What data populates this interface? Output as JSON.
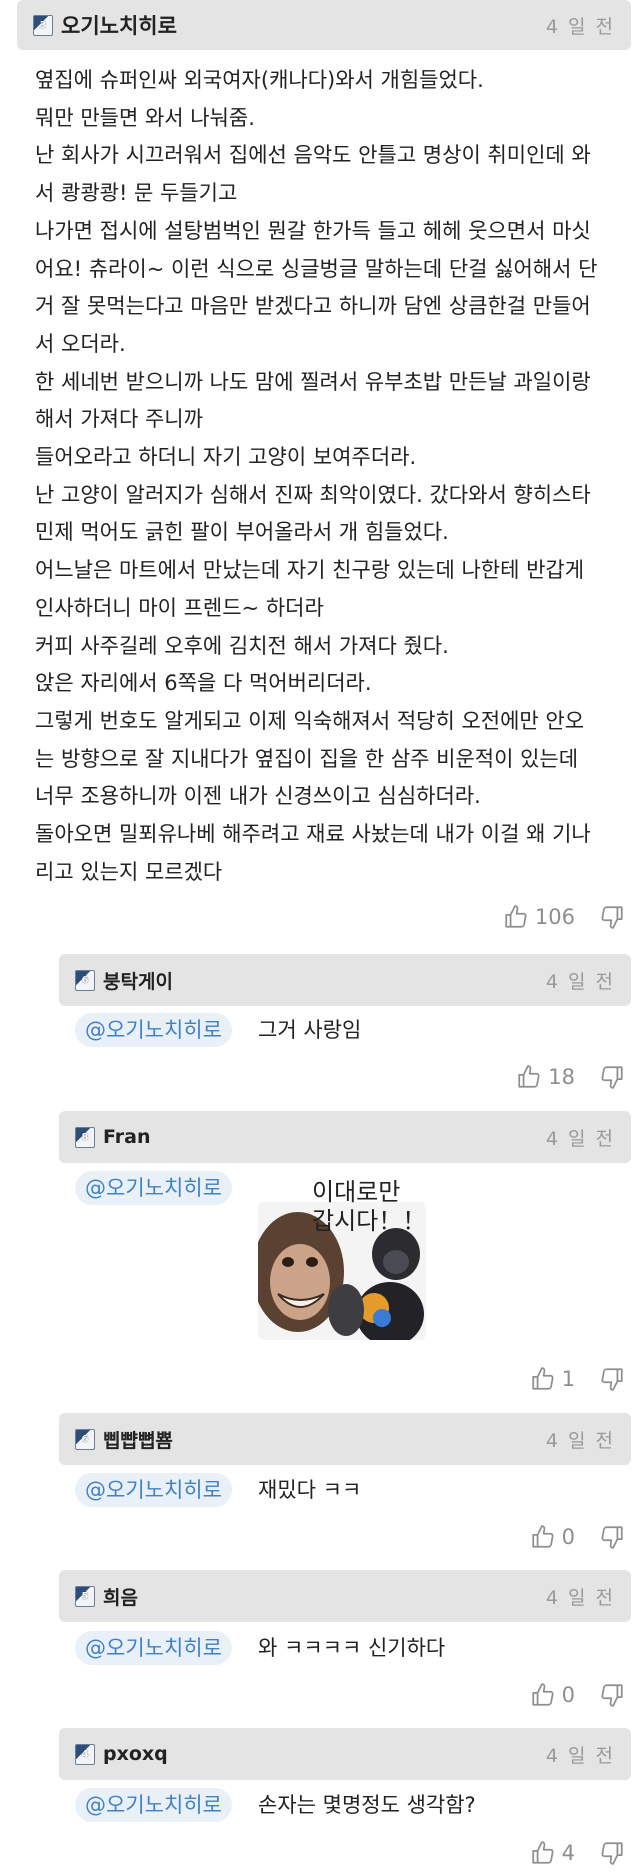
{
  "main_comment": {
    "level": "3",
    "nickname": "오기노치히로",
    "time": "4 일 전",
    "lines": [
      "옆집에 슈퍼인싸 외국여자(캐나다)와서 개힘들었다.",
      "뭐만 만들면 와서 나눠줌.",
      "난 회사가 시끄러워서 집에선 음악도 안틀고 명상이 취미인데 와",
      "서 쾅쾅쾅! 문 두들기고",
      "나가면 접시에 설탕범벅인 뭔갈 한가득 들고 헤헤 웃으면서 마싯",
      "어요! 츄라이~ 이런 식으로 싱글벙글 말하는데 단걸 싫어해서 단",
      "거 잘 못먹는다고 마음만 받겠다고 하니까 담엔 상큼한걸 만들어",
      "서 오더라.",
      "한 세네번 받으니까 나도 맘에 찔려서 유부초밥 만든날 과일이랑",
      "해서 가져다 주니까",
      "들어오라고 하더니 자기 고양이 보여주더라.",
      "난 고양이 알러지가 심해서 진짜 최악이였다. 갔다와서 향히스타",
      "민제 먹어도 긁힌 팔이 부어올라서 개 힘들었다.",
      "어느날은 마트에서 만났는데 자기 친구랑 있는데 나한테 반갑게",
      "인사하더니 마이 프렌드~ 하더라",
      "커피 사주길레 오후에 김치전 해서 가져다 줬다.",
      "앉은 자리에서 6쪽을 다 먹어버리더라.",
      "그렇게 번호도 알게되고 이제 익숙해져서 적당히 오전에만 안오",
      "는 방향으로 잘 지내다가 옆집이 집을 한 삼주 비운적이 있는데",
      "너무 조용하니까 이젠 내가 신경쓰이고 심심하더라.",
      "돌아오면 밀푀유나베 해주려고 재료 사놨는데 내가 이걸 왜 기나",
      "리고 있는지 모르겠다"
    ],
    "likes": "106"
  },
  "replies": [
    {
      "level": "6",
      "nickname": "붕탁게이",
      "time": "4 일 전",
      "mention": "@오기노치히로",
      "text": "그거 사랑임",
      "likes": "18"
    },
    {
      "level": "8",
      "nickname": "Fran",
      "time": "4 일 전",
      "mention": "@오기노치히로",
      "sticker_text_1": "이대로만",
      "sticker_text_2": "갑시다！！",
      "likes": "1"
    },
    {
      "level": "6",
      "nickname": "삡뺩뼙뿀",
      "time": "4 일 전",
      "mention": "@오기노치히로",
      "text": "재밌다 ㅋㅋ",
      "likes": "0"
    },
    {
      "level": "5",
      "nickname": "희음",
      "time": "4 일 전",
      "mention": "@오기노치히로",
      "text": "와 ㅋㅋㅋㅋ 신기하다",
      "likes": "0"
    },
    {
      "level": "4",
      "nickname": "pxoxq",
      "time": "4 일 전",
      "mention": "@오기노치히로",
      "text": "손자는 몇명정도 생각함?",
      "likes": "4"
    }
  ],
  "icons": {
    "like": "thumbs-up-icon",
    "dislike": "thumbs-down-icon",
    "level": "level-badge-icon"
  },
  "colors": {
    "header_bg": "#e4e4e4",
    "mention_text": "#3f82c6",
    "mention_bg": "#eaf0f7",
    "muted": "#9a9a9a"
  }
}
